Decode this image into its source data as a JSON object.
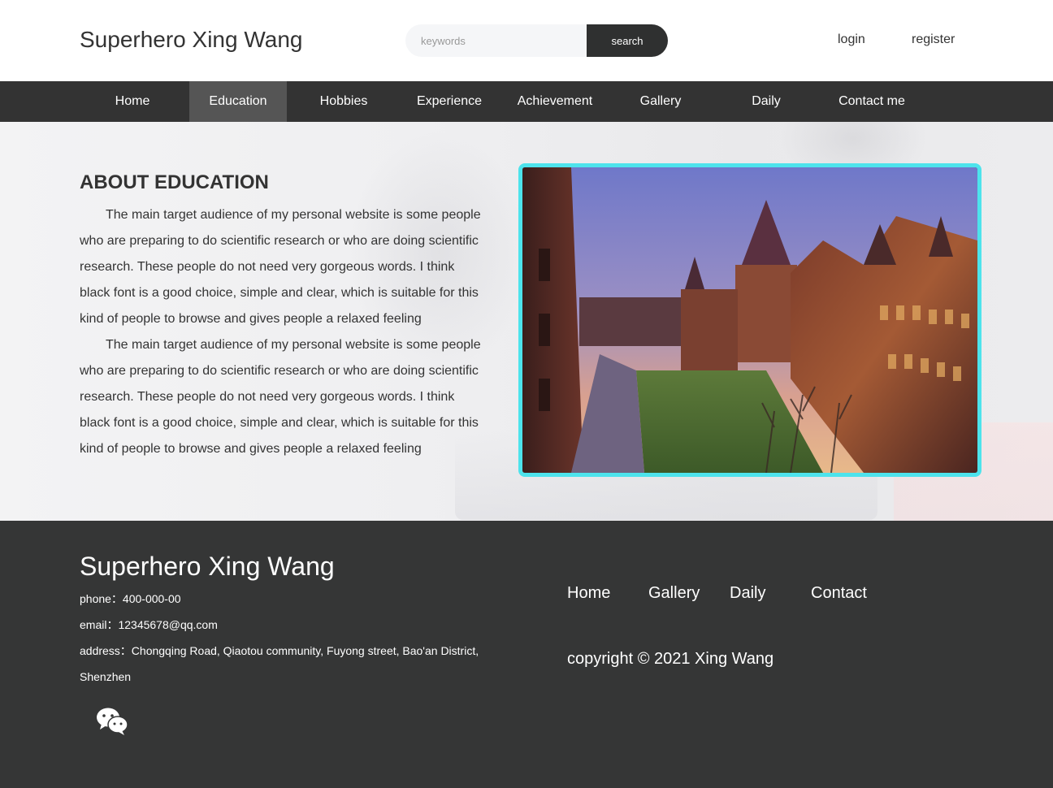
{
  "header": {
    "site_title": "Superhero Xing Wang",
    "search_placeholder": "keywords",
    "search_button": "search",
    "login": "login",
    "register": "register"
  },
  "nav": {
    "items": [
      {
        "label": "Home",
        "active": false
      },
      {
        "label": "Education",
        "active": true
      },
      {
        "label": "Hobbies",
        "active": false
      },
      {
        "label": "Experience",
        "active": false
      },
      {
        "label": "Achievement",
        "active": false
      },
      {
        "label": "Gallery",
        "active": false
      },
      {
        "label": "Daily",
        "active": false
      },
      {
        "label": "Contact me",
        "active": false
      }
    ]
  },
  "main": {
    "title": "ABOUT EDUCATION",
    "paragraphs": [
      "The main target audience of my personal website is some people who are preparing to do scientific research or who are doing scientific research. These people do not need very gorgeous words. I think black font is a good choice, simple and clear, which is suitable for this kind of people to browse and gives people a relaxed feeling",
      "The main target audience of my personal website is some people who are preparing to do scientific research or who are doing scientific research. These people do not need very gorgeous words. I think black font is a good choice, simple and clear, which is suitable for this kind of people to browse and gives people a relaxed feeling"
    ],
    "photo_border_color": "#4de3ec"
  },
  "footer": {
    "title": "Superhero Xing Wang",
    "phone": "phone：400-000-00",
    "email": "email：12345678@qq.com",
    "address": "address：Chongqing Road, Qiaotou community, Fuyong street, Bao'an District, Shenzhen",
    "links": [
      "Home",
      "Gallery",
      "Daily",
      "Contact"
    ],
    "copyright": "copyright © 2021 Xing Wang",
    "social_icon": "wechat-icon"
  },
  "colors": {
    "nav_bg": "#333333",
    "nav_active_bg": "#555555",
    "footer_bg": "#353636",
    "search_button_bg": "#2f3030"
  }
}
